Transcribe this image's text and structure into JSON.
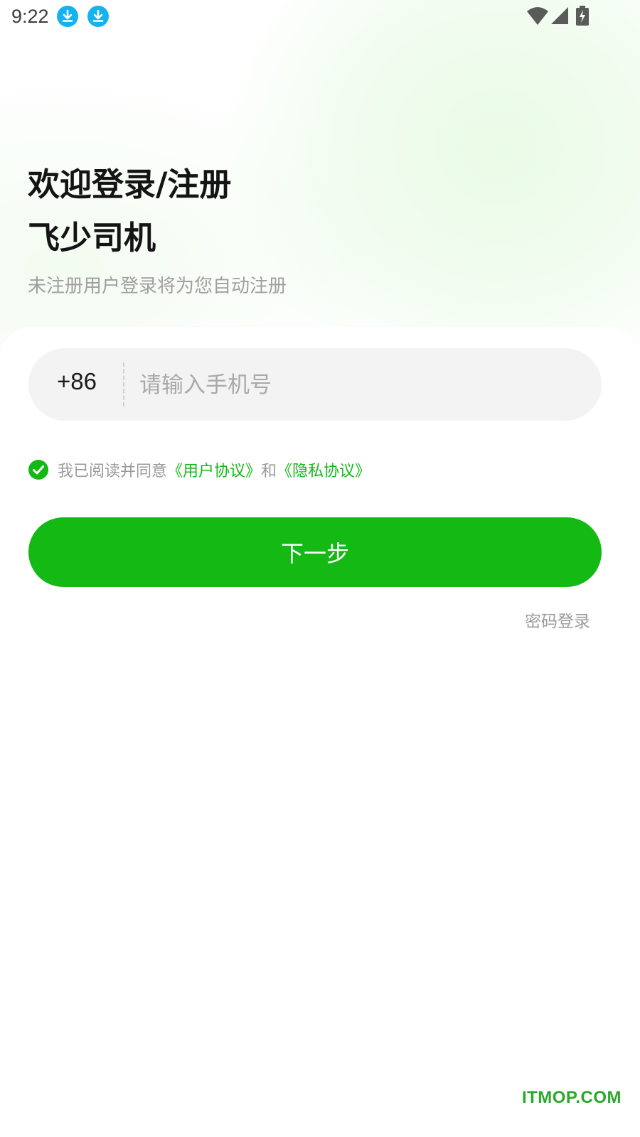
{
  "status_bar": {
    "time": "9:22"
  },
  "header": {
    "title_line1": "欢迎登录/注册",
    "title_line2": "飞少司机",
    "subtitle": "未注册用户登录将为您自动注册"
  },
  "phone": {
    "country_code": "+86",
    "placeholder": "请输入手机号",
    "value": ""
  },
  "agreement": {
    "checked": true,
    "prefix": "我已阅读并同意",
    "user_agreement": "《用户协议》",
    "conjunction": "和",
    "privacy_agreement": "《隐私协议》"
  },
  "actions": {
    "next_label": "下一步",
    "password_login_label": "密码登录"
  },
  "watermark": "ITMOP.COM",
  "colors": {
    "accent": "#14b914",
    "link": "#14b814",
    "download_icon": "#15b2f0"
  },
  "icons": [
    "download-icon",
    "download-icon",
    "wifi-icon",
    "cellular-signal-icon",
    "battery-charging-icon",
    "checkmark-icon"
  ]
}
